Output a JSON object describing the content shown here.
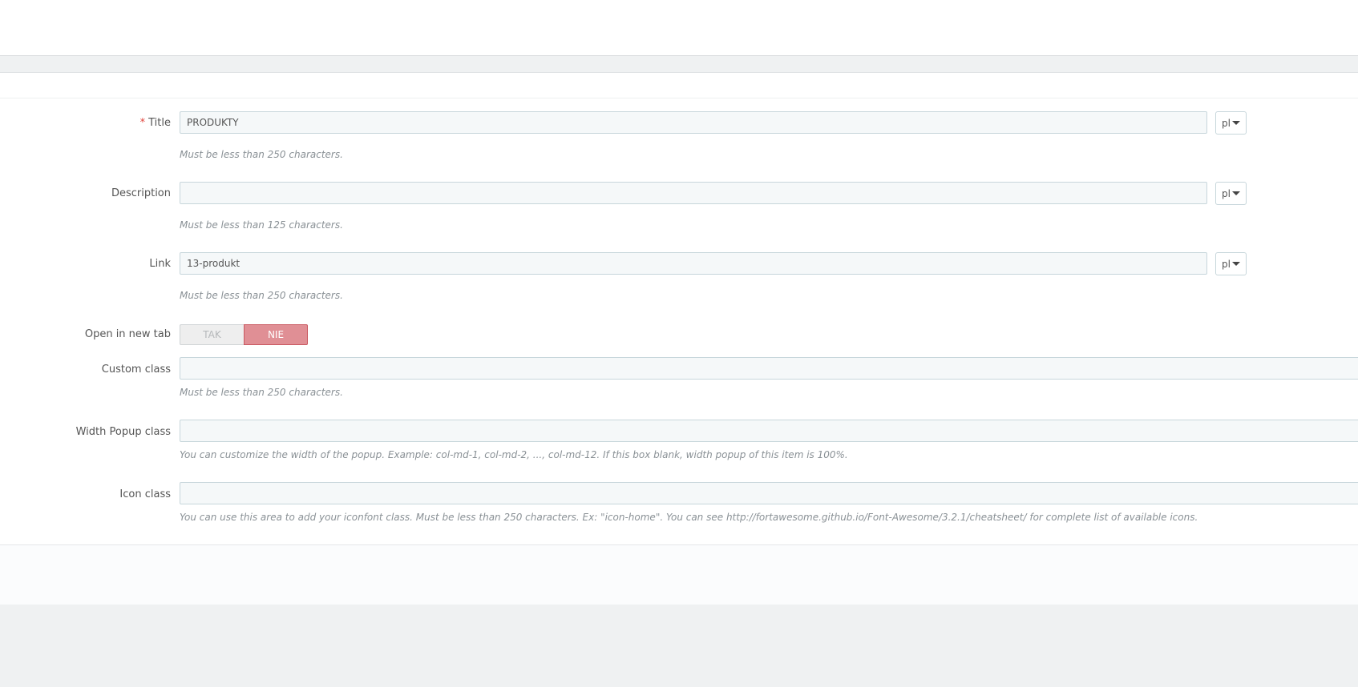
{
  "form": {
    "title": {
      "required_mark": "*",
      "label": "Title",
      "value": "PRODUKTY",
      "lang": "pl",
      "help": "Must be less than 250 characters."
    },
    "description": {
      "label": "Description",
      "value": "",
      "lang": "pl",
      "help": "Must be less than 125 characters."
    },
    "link": {
      "label": "Link",
      "value": "13-produkt",
      "lang": "pl",
      "help": "Must be less than 250 characters."
    },
    "open_new_tab": {
      "label": "Open in new tab",
      "yes": "TAK",
      "no": "NIE",
      "selected": "NIE"
    },
    "custom_class": {
      "label": "Custom class",
      "value": "",
      "help": "Must be less than 250 characters."
    },
    "width_popup": {
      "label": "Width Popup class",
      "value": "",
      "help": "You can customize the width of the popup. Example: col-md-1, col-md-2, ..., col-md-12. If this box blank, width popup of this item is 100%."
    },
    "icon_class": {
      "label": "Icon class",
      "value": "",
      "help": "You can use this area to add your iconfont class. Must be less than 250 characters. Ex: \"icon-home\". You can see http://fortawesome.github.io/Font-Awesome/3.2.1/cheatsheet/ for complete list of available icons."
    }
  },
  "colors": {
    "toggle_active": "#e08f95",
    "required": "#e0443c",
    "input_bg": "#f5f8f9"
  }
}
